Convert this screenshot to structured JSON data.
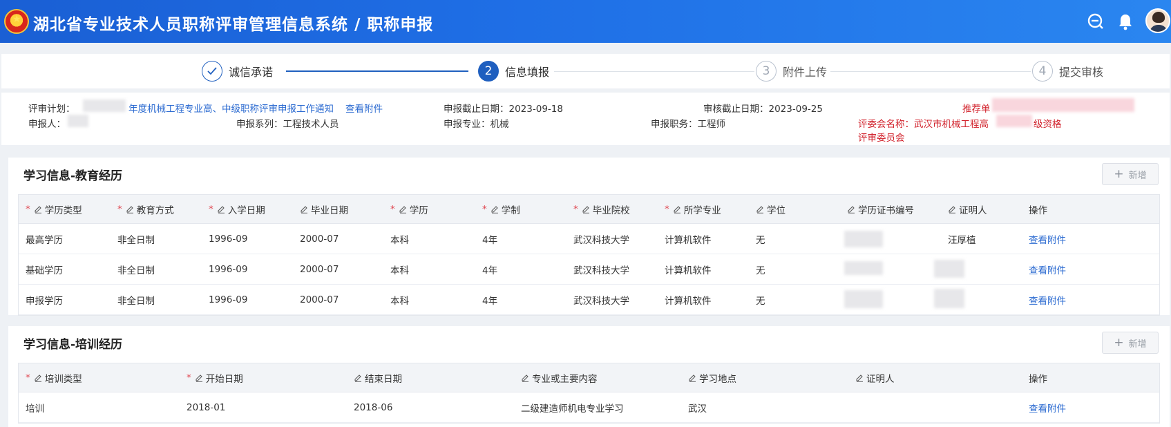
{
  "header": {
    "title": "湖北省专业技术人员职称评审管理信息系统 / 职称申报",
    "colors": {
      "bar": "#1f6fe6",
      "accent": "#1f5fbf"
    }
  },
  "steps": [
    {
      "num": "✓",
      "label": "诚信承诺",
      "state": "done"
    },
    {
      "num": "2",
      "label": "信息填报",
      "state": "active"
    },
    {
      "num": "3",
      "label": "附件上传",
      "state": "pending"
    },
    {
      "num": "4",
      "label": "提交审核",
      "state": "pending"
    }
  ],
  "info": {
    "plan_label": "评审计划：",
    "plan_value": "年度机械工程专业高、中级职称评审申报工作通知",
    "plan_link": "查看附件",
    "deadline": "申报截止日期：2023-09-18",
    "review_deadline": "审核截止日期：2023-09-25",
    "recommend": "推荐单",
    "applicant": "申报人：",
    "series": "申报系列：工程技术人员",
    "major": "申报专业：机械",
    "position": "申报职务：工程师",
    "committee_a": "评委会名称：武汉市机械工程高",
    "committee_b": "级资格",
    "committee_c": "评审委员会"
  },
  "education": {
    "title": "学习信息-教育经历",
    "add_label": "新增",
    "columns": [
      {
        "label": "学历类型",
        "req": true
      },
      {
        "label": "教育方式",
        "req": true
      },
      {
        "label": "入学日期",
        "req": true
      },
      {
        "label": "毕业日期",
        "req": false
      },
      {
        "label": "学历",
        "req": true
      },
      {
        "label": "学制",
        "req": true
      },
      {
        "label": "毕业院校",
        "req": true
      },
      {
        "label": "所学专业",
        "req": true
      },
      {
        "label": "学位",
        "req": false
      },
      {
        "label": "学历证书编号",
        "req": false
      },
      {
        "label": "证明人",
        "req": false
      },
      {
        "label": "操作",
        "req": false
      }
    ],
    "rows": [
      [
        "最高学历",
        "非全日制",
        "1996-09",
        "2000-07",
        "本科",
        "4年",
        "武汉科技大学",
        "计算机软件",
        "无",
        "",
        "汪厚植",
        "查看附件"
      ],
      [
        "基础学历",
        "非全日制",
        "1996-09",
        "2000-07",
        "本科",
        "4年",
        "武汉科技大学",
        "计算机软件",
        "无",
        "",
        "",
        "查看附件"
      ],
      [
        "申报学历",
        "非全日制",
        "1996-09",
        "2000-07",
        "本科",
        "4年",
        "武汉科技大学",
        "计算机软件",
        "无",
        "",
        "",
        "查看附件"
      ]
    ]
  },
  "training": {
    "title": "学习信息-培训经历",
    "add_label": "新增",
    "columns": [
      {
        "label": "培训类型",
        "req": true
      },
      {
        "label": "开始日期",
        "req": true
      },
      {
        "label": "结束日期",
        "req": false
      },
      {
        "label": "专业或主要内容",
        "req": false
      },
      {
        "label": "学习地点",
        "req": false
      },
      {
        "label": "证明人",
        "req": false
      },
      {
        "label": "操作",
        "req": false
      }
    ],
    "rows": [
      [
        "培训",
        "2018-01",
        "2018-06",
        "二级建造师机电专业学习",
        "武汉",
        "",
        "查看附件"
      ]
    ]
  }
}
